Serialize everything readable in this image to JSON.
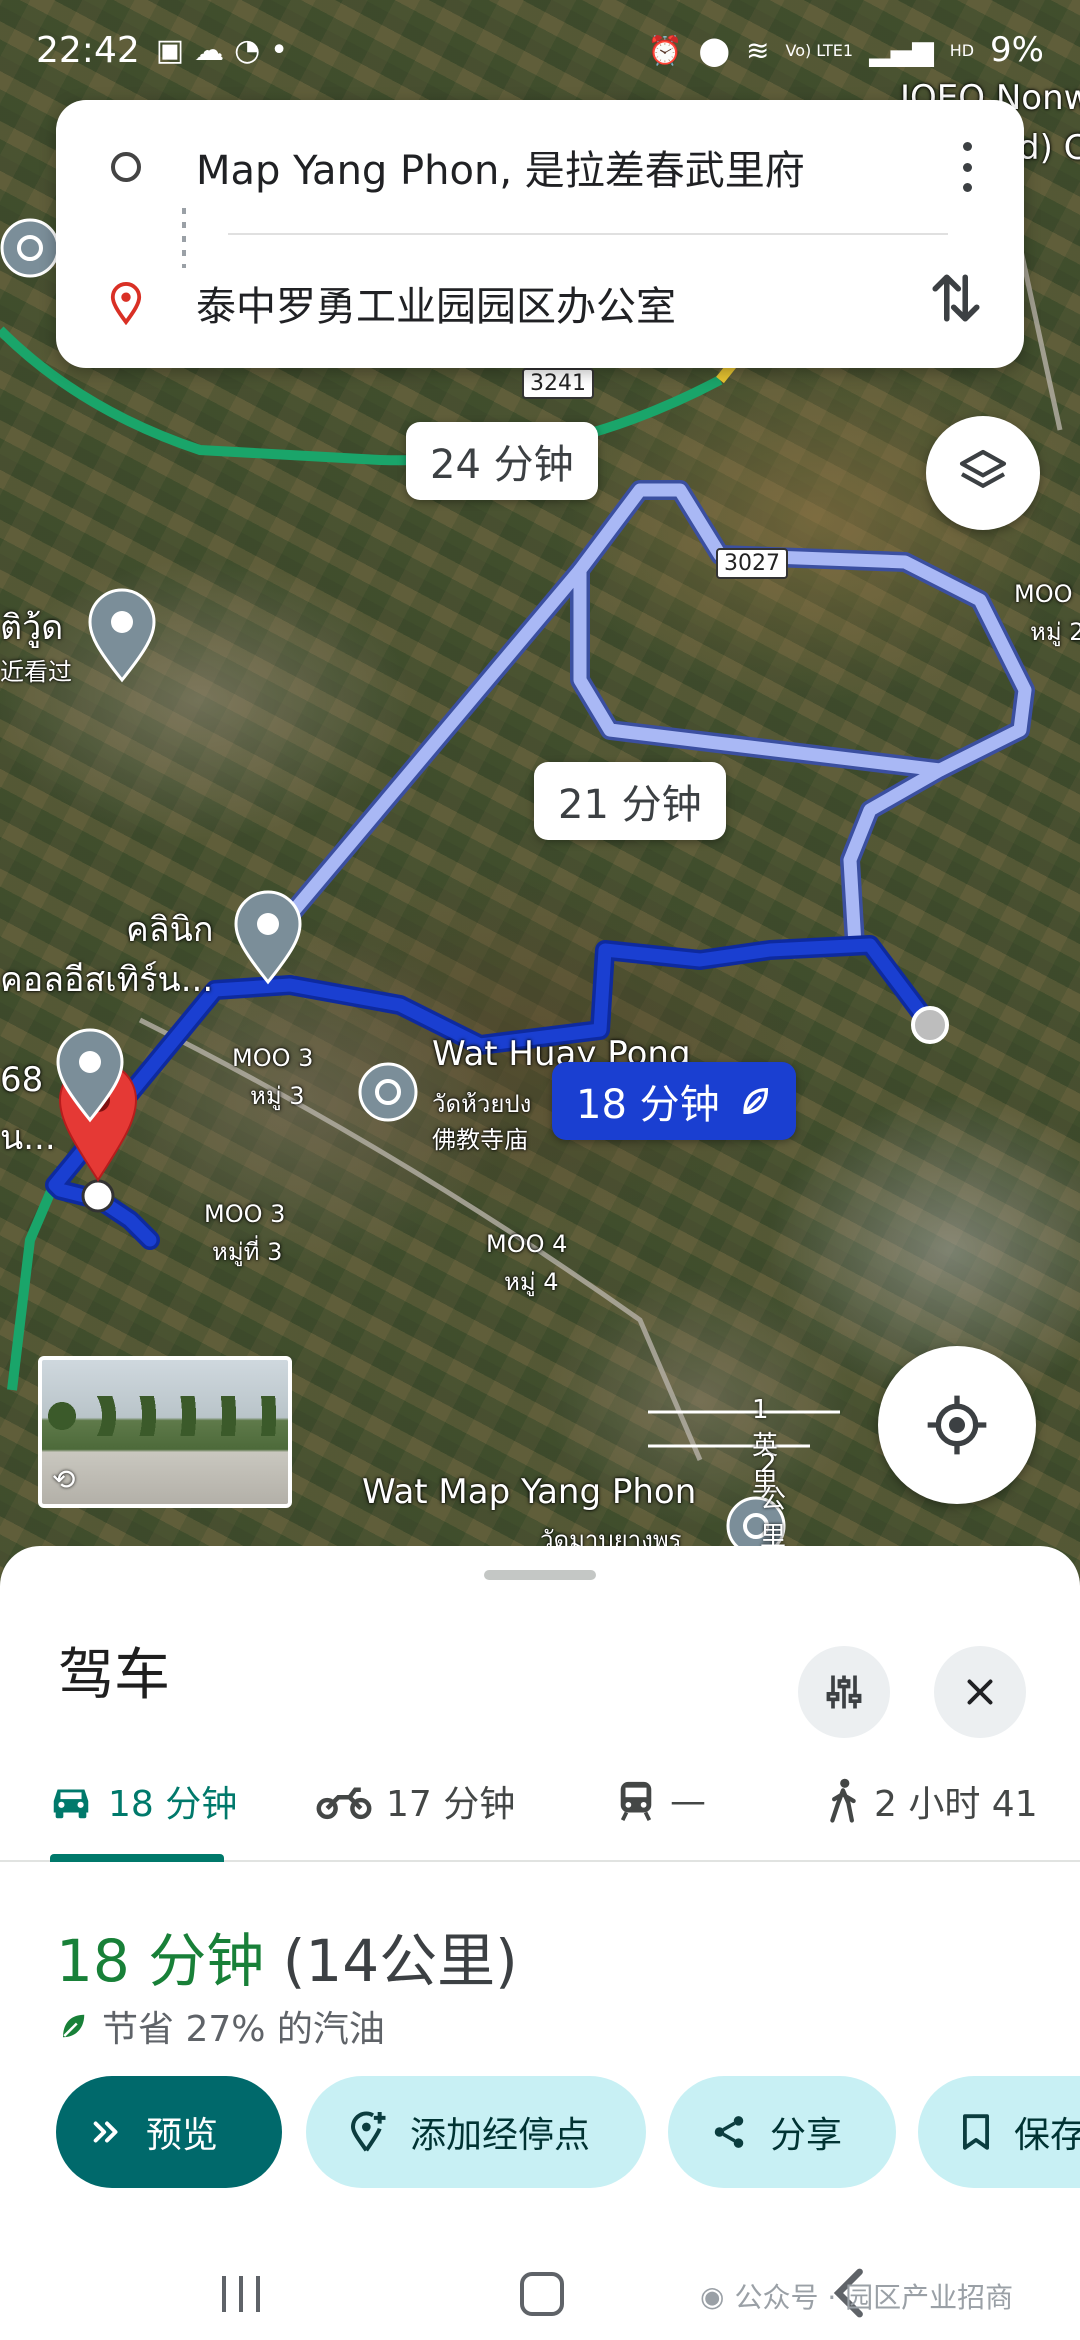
{
  "status_bar": {
    "time": "22:42",
    "left_icons": [
      "gallery-icon",
      "cloud-icon",
      "line-icon",
      "dot-icon"
    ],
    "right_icons": [
      "alarm-icon",
      "location-icon",
      "wifi-icon",
      "volte-icon",
      "signal-icon",
      "hd-signal-icon"
    ],
    "volte_label": "Vo) LTE1",
    "hd_label": "HD",
    "battery": "9%"
  },
  "route_input": {
    "origin": "Map Yang Phon, 是拉差春武里府",
    "destination": "泰中罗勇工业园园区办公室"
  },
  "map": {
    "route_bubbles": {
      "alt1": "24 分钟",
      "alt2": "21 分钟",
      "best": "18 分钟"
    },
    "labels": {
      "road_3241": "3241",
      "road_3027": "3027",
      "top_right": "JOEO Nonw",
      "top_right2": "d) C",
      "moo_right": "MOO",
      "moo_right_th": "หมู่ 2",
      "left_th1": "ติวู้ด",
      "left_th1b": "近看过",
      "clinic": "คลินิก",
      "clinic2": "คอลอีสเทิร์น...",
      "left_num": "68",
      "left_num2": "น...",
      "moo3a": "MOO 3",
      "moo3a_th": "หมู่ 3",
      "moo3b": "MOO 3",
      "moo3b_th": "หมู่ที่ 3",
      "moo4": "MOO 4",
      "moo4_th": "หมู่ 4",
      "wat_huay": "Wat Huay Pong",
      "wat_huay_th": "วัดห้วยปง",
      "wat_huay_cn": "佛教寺庙",
      "wat_map": "Wat Map Yang Phon",
      "wat_map_th": "วัดมาบยางพร"
    },
    "scale": {
      "miles": "1 英里",
      "km": "2公里"
    }
  },
  "sheet": {
    "title": "驾车",
    "modes": [
      {
        "icon": "car-icon",
        "label": "18 分钟"
      },
      {
        "icon": "motorcycle-icon",
        "label": "17 分钟"
      },
      {
        "icon": "transit-icon",
        "label": "—"
      },
      {
        "icon": "walk-icon",
        "label": "2 小时 41"
      }
    ],
    "summary_time": "18 分钟",
    "summary_distance": "(14公里)",
    "fuel_note": "节省 27% 的汽油",
    "actions": {
      "preview": "预览",
      "add_stop": "添加经停点",
      "share": "分享",
      "save": "保存"
    }
  },
  "watermark": "公众号 · 园区产业招商",
  "colors": {
    "route_best": "#1a3fd1",
    "route_alt": "#a9b8f5",
    "accent_teal": "#00796b",
    "time_green": "#188038",
    "chip_bg": "#c8f0f4"
  }
}
